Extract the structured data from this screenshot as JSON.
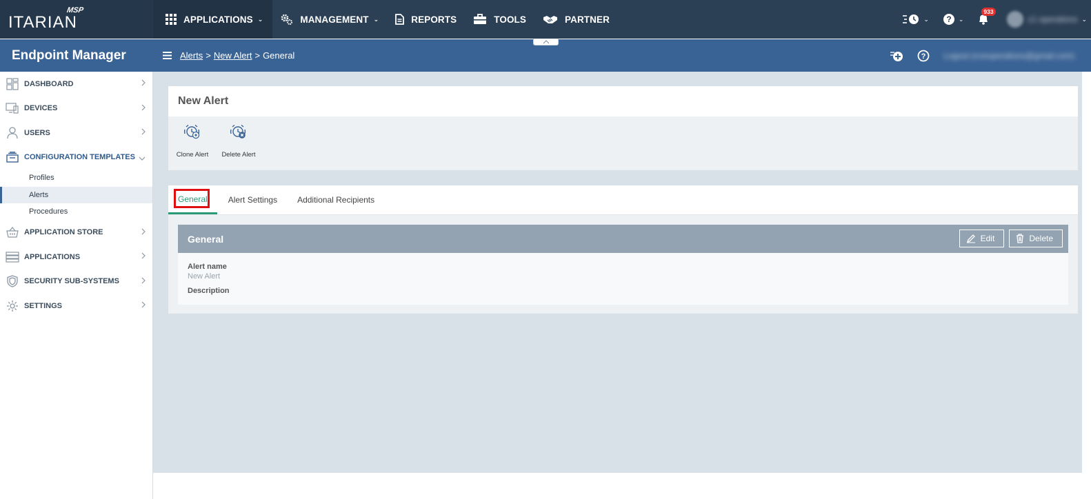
{
  "logo": {
    "brand": "ITARIAN",
    "tag": "MSP"
  },
  "topnav": {
    "items": [
      {
        "label": "APPLICATIONS",
        "icon": "grid-icon"
      },
      {
        "label": "MANAGEMENT",
        "icon": "gears-icon"
      },
      {
        "label": "REPORTS",
        "icon": "report-icon"
      },
      {
        "label": "TOOLS",
        "icon": "toolbox-icon"
      },
      {
        "label": "PARTNER",
        "icon": "handshake-icon"
      }
    ],
    "notification_count": "933",
    "user_blurred": "c1 operations"
  },
  "app_title": "Endpoint Manager",
  "breadcrumb": {
    "items": [
      "Alerts",
      "New Alert",
      "General"
    ],
    "separator": ">",
    "user_blurred": "Logout (cceoperations@gmail.com)"
  },
  "sidebar": {
    "items": [
      {
        "label": "DASHBOARD"
      },
      {
        "label": "DEVICES"
      },
      {
        "label": "USERS"
      },
      {
        "label": "CONFIGURATION TEMPLATES"
      },
      {
        "label": "APPLICATION STORE"
      },
      {
        "label": "APPLICATIONS"
      },
      {
        "label": "SECURITY SUB-SYSTEMS"
      },
      {
        "label": "SETTINGS"
      }
    ],
    "sub_items": [
      {
        "label": "Profiles"
      },
      {
        "label": "Alerts"
      },
      {
        "label": "Procedures"
      }
    ]
  },
  "page": {
    "title": "New Alert",
    "toolbar": {
      "clone_label": "Clone Alert",
      "delete_label": "Delete Alert"
    },
    "tabs": [
      {
        "label": "General"
      },
      {
        "label": "Alert Settings"
      },
      {
        "label": "Additional Recipients"
      }
    ],
    "section": {
      "title": "General",
      "edit_label": "Edit",
      "delete_label": "Delete",
      "fields": {
        "alert_name_label": "Alert name",
        "alert_name_value": "New Alert",
        "description_label": "Description"
      }
    }
  },
  "colors": {
    "topbar": "#2b3f55",
    "accent_blue": "#3a6395",
    "active_tab": "#2a9a74",
    "highlight_box": "#e01010",
    "section_header": "#93a3b1"
  }
}
